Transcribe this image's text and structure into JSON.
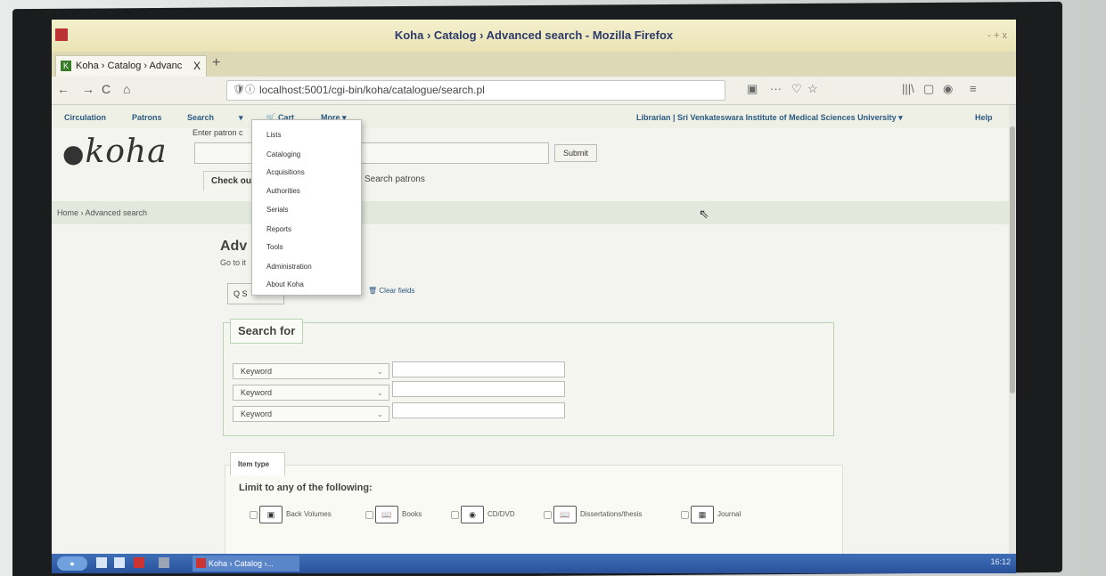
{
  "window": {
    "title": "Koha › Catalog › Advanced search - Mozilla Firefox",
    "controls": "- + x"
  },
  "tab": {
    "label": "Koha › Catalog › Advanc",
    "close": "X",
    "new_tab": "+",
    "favicon": "K"
  },
  "nav": {
    "back": "←",
    "forward": "→",
    "reload": "C",
    "home": "⌂",
    "url": "localhost:5001/cgi-bin/koha/catalogue/search.pl",
    "shield": "🛡",
    "info": "ⓘ",
    "reader": "▣",
    "more": "···",
    "pocket": "♡",
    "star": "☆",
    "library": "|||\\",
    "sidebar": "▢",
    "account": "◉",
    "menu": "≡"
  },
  "koha_nav": {
    "circulation": "Circulation",
    "patrons": "Patrons",
    "search": "Search",
    "search_caret": "▾",
    "cart": "Cart",
    "cart_icon": "cart-icon",
    "more": "More ▾",
    "user": "Librarian | Sri Venkateswara Institute of Medical Sciences University ▾",
    "help": "Help"
  },
  "logo": {
    "text": "koha"
  },
  "patron": {
    "label": "Enter patron c",
    "submit": "Submit",
    "checkout_tab": "Check ou",
    "search_patrons": "Search patrons"
  },
  "breadcrumb": "Home › Advanced search",
  "page": {
    "title": "Adv",
    "goto": "Go to it",
    "search_button": "Q S",
    "clear_fields": "Clear fields"
  },
  "more_menu": [
    "Lists",
    "Cataloging",
    "Acquisitions",
    "Authorities",
    "Serials",
    "Reports",
    "Tools",
    "Administration",
    "About Koha"
  ],
  "search_for": {
    "legend": "Search for",
    "rows": [
      {
        "index": "Keyword",
        "value": ""
      },
      {
        "index": "Keyword",
        "value": ""
      },
      {
        "index": "Keyword",
        "value": ""
      }
    ]
  },
  "item_type": {
    "tab": "Item type",
    "limit_label": "Limit to any of the following:",
    "options": [
      "Back Volumes",
      "Books",
      "CD/DVD",
      "Dissertations/thesis",
      "Journal"
    ]
  },
  "taskbar": {
    "task_label": "Koha › Catalog ›...",
    "time": "16:12"
  }
}
